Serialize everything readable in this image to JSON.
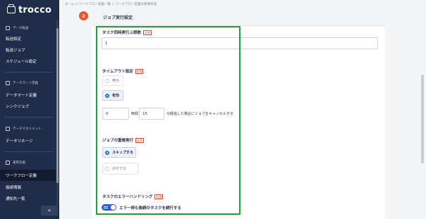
{
  "sidebar": {
    "logo": "trocco",
    "sections": [
      {
        "title": "データ転送",
        "items": [
          "転送設定",
          "転送ジョブ",
          "スケジュール設定"
        ]
      },
      {
        "title": "データマート定義",
        "items": [
          "データマート定義",
          "シンクジョブ"
        ]
      },
      {
        "title": "データマネジメント",
        "items": [
          "データリネージ"
        ]
      },
      {
        "title": "運用支援",
        "items": [
          "ワークフロー定義",
          "接続情報",
          "通知先一覧"
        ]
      }
    ],
    "active_item": "ワークフロー定義",
    "collapse_glyph": "«"
  },
  "breadcrumb": [
    "ホーム",
    "ワークフロー定義一覧",
    "ワークフロー定義の新規作成"
  ],
  "breadcrumb_separator": ">",
  "step": {
    "number": "2",
    "title": "ジョブ実行設定"
  },
  "form": {
    "concurrency": {
      "label": "タスク同時実行上限数",
      "required": "必須",
      "value": "1"
    },
    "timeout": {
      "label": "タイムアウト設定",
      "required": "必須",
      "options": [
        {
          "label": "無効",
          "selected": false
        },
        {
          "label": "有効",
          "selected": true
        }
      ],
      "hours": "0",
      "hours_unit": "時間",
      "minutes": "15",
      "minutes_suffix": "分経過した場合にジョブをキャンセルする"
    },
    "duplicate": {
      "label": "ジョブの重複実行",
      "required": "必須",
      "options": [
        {
          "label": "スキップする",
          "selected": true
        },
        {
          "label": "許可する",
          "selected": false
        }
      ]
    },
    "error_handling": {
      "label": "タスクのエラーハンドリング",
      "required": "必須",
      "toggle_on": true,
      "toggle_text": "エラー時も後続のタスクを続行する"
    }
  },
  "colors": {
    "sidebar": "#1f2d4a",
    "accent": "#2b6fd6",
    "step": "#e0592a",
    "required": "#d8482f",
    "highlight": "#21a038"
  }
}
